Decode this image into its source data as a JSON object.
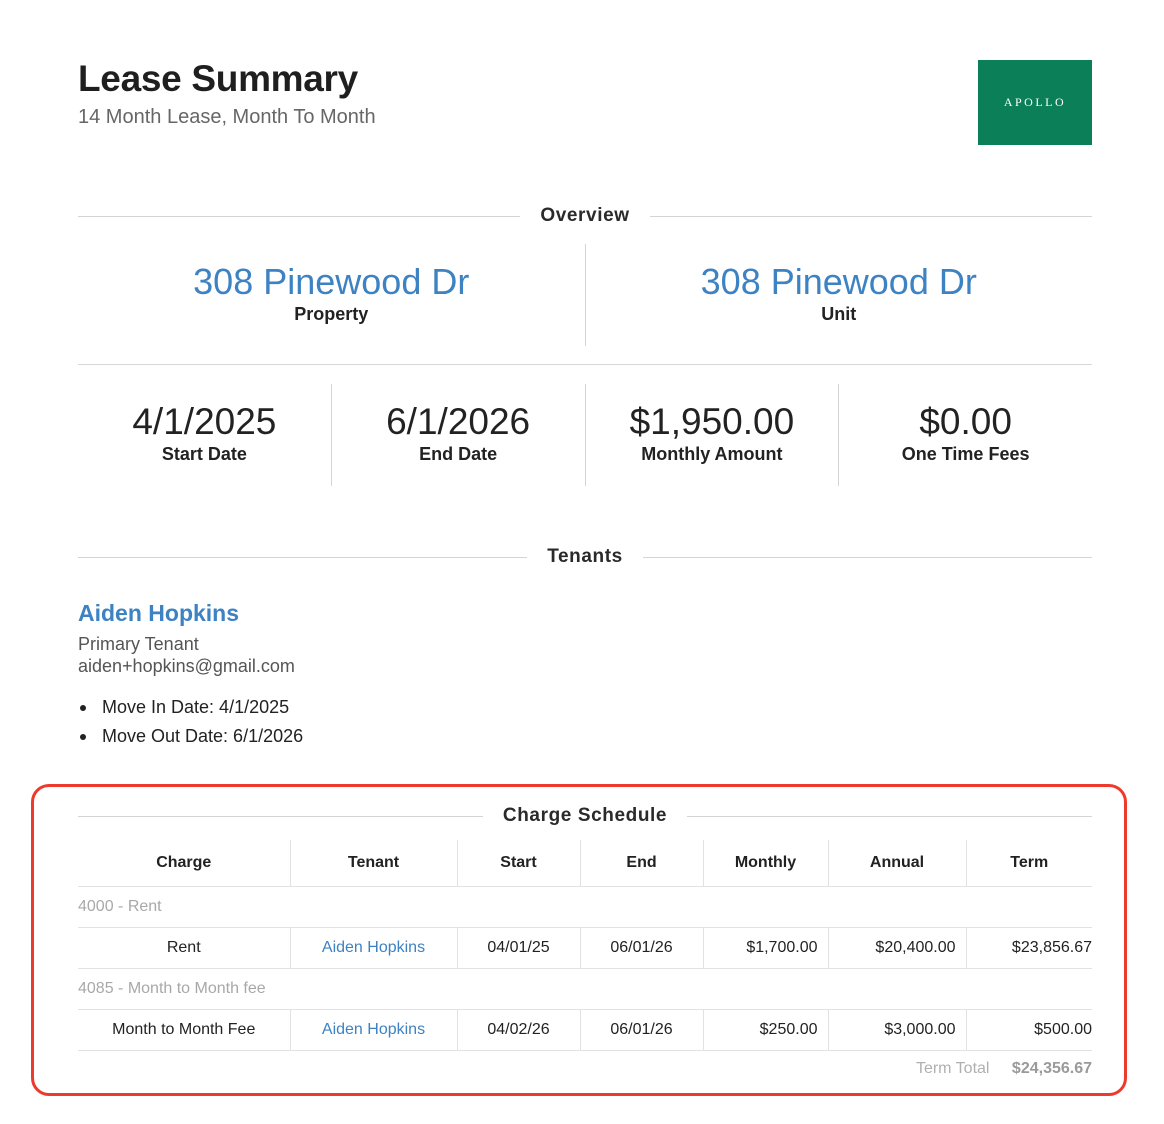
{
  "header": {
    "title": "Lease Summary",
    "subtitle": "14 Month Lease, Month To Month",
    "logo_text": "APOLLO",
    "logo_color": "#0b7f58"
  },
  "overview": {
    "section_title": "Overview",
    "property": {
      "value": "308 Pinewood Dr",
      "label": "Property"
    },
    "unit": {
      "value": "308 Pinewood Dr",
      "label": "Unit"
    },
    "start_date": {
      "value": "4/1/2025",
      "label": "Start Date"
    },
    "end_date": {
      "value": "6/1/2026",
      "label": "End Date"
    },
    "monthly_amount": {
      "value": "$1,950.00",
      "label": "Monthly Amount"
    },
    "one_time_fees": {
      "value": "$0.00",
      "label": "One Time Fees"
    }
  },
  "tenants": {
    "section_title": "Tenants",
    "items": [
      {
        "name": "Aiden Hopkins",
        "role": "Primary Tenant",
        "email": "aiden+hopkins@gmail.com",
        "move_in": "Move In Date: 4/1/2025",
        "move_out": "Move Out Date: 6/1/2026"
      }
    ]
  },
  "charge_schedule": {
    "section_title": "Charge Schedule",
    "columns": [
      "Charge",
      "Tenant",
      "Start",
      "End",
      "Monthly",
      "Annual",
      "Term"
    ],
    "groups": [
      {
        "label": "4000 - Rent",
        "row": {
          "charge": "Rent",
          "tenant": "Aiden Hopkins",
          "start": "04/01/25",
          "end": "06/01/26",
          "monthly": "$1,700.00",
          "annual": "$20,400.00",
          "term": "$23,856.67"
        }
      },
      {
        "label": "4085 - Month to Month fee",
        "row": {
          "charge": "Month to Month Fee",
          "tenant": "Aiden Hopkins",
          "start": "04/02/26",
          "end": "06/01/26",
          "monthly": "$250.00",
          "annual": "$3,000.00",
          "term": "$500.00"
        }
      }
    ],
    "term_total_label": "Term Total",
    "term_total_value": "$24,356.67"
  },
  "highlight_color": "#ee3a2c"
}
